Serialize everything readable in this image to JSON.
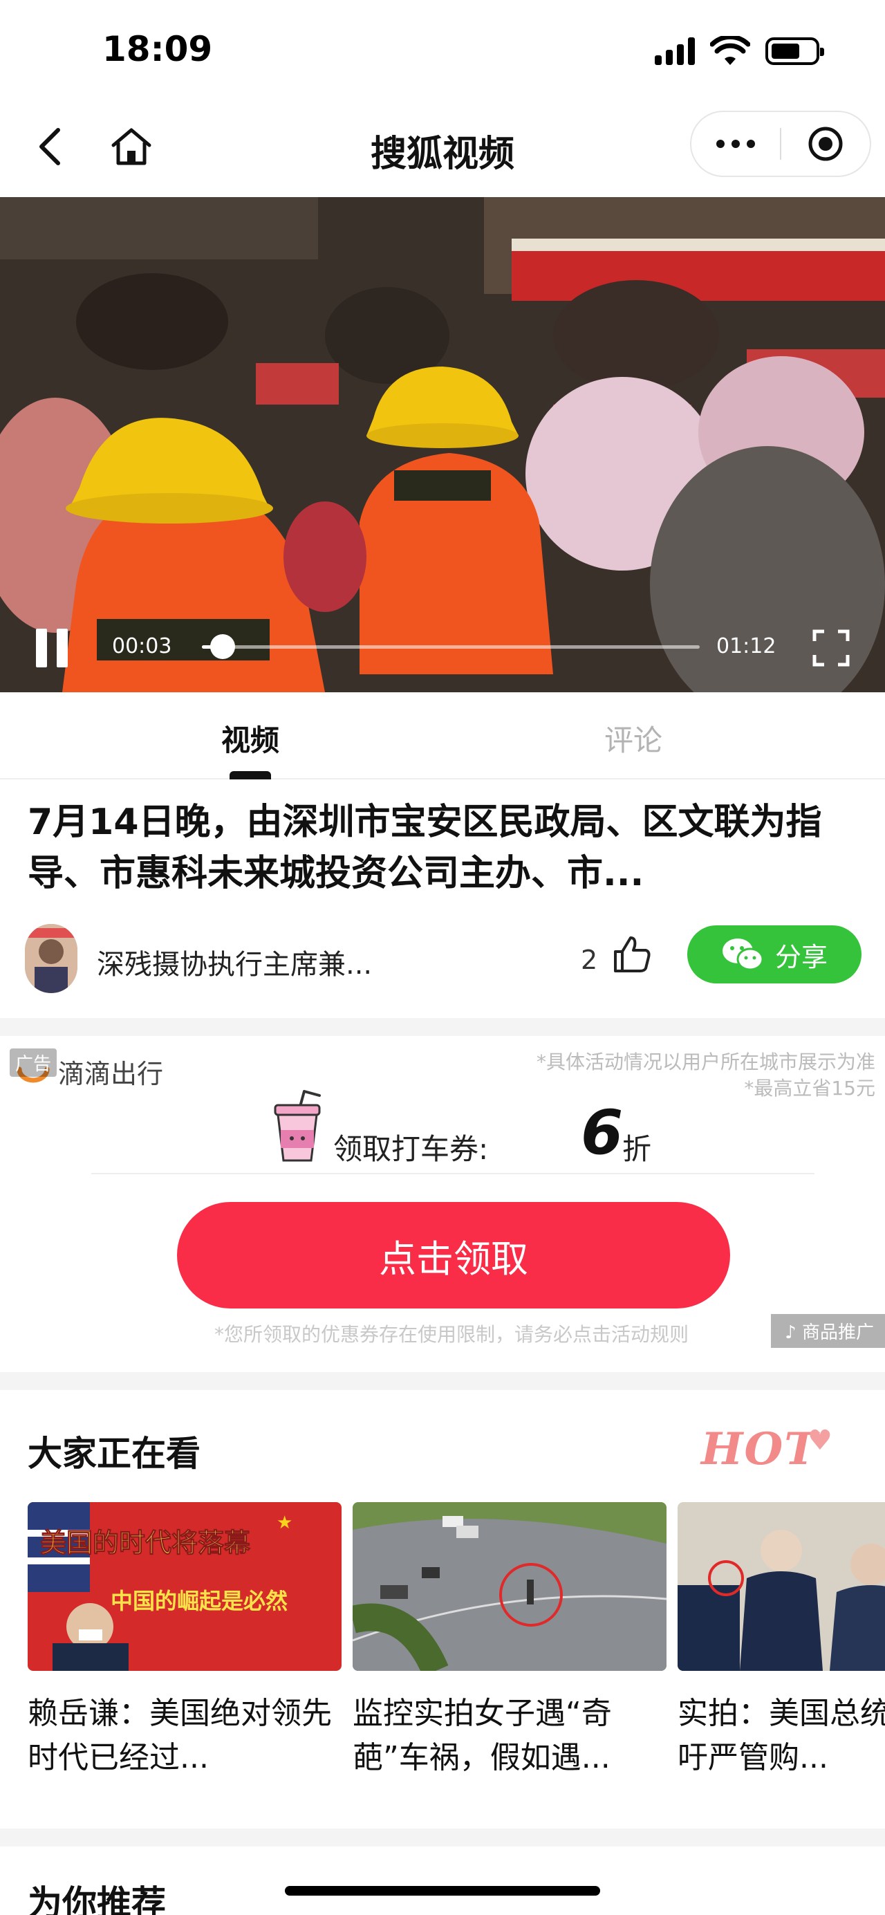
{
  "status_bar": {
    "time": "18:09"
  },
  "nav": {
    "title": "搜狐视频"
  },
  "player": {
    "current_time": "00:03",
    "total_time": "01:12",
    "progress": 0.042
  },
  "tabs": [
    {
      "label": "视频"
    },
    {
      "label": "评论"
    }
  ],
  "article": {
    "title": "7月14日晚，由深圳市宝安区民政局、区文联为指导、市惠科未来城投资公司主办、市...",
    "author": "深残摄协执行主席兼...",
    "likes": "2",
    "share_label": "分享"
  },
  "ad": {
    "badge": "广告",
    "brand": "滴滴出行",
    "note_1": "*具体活动情况以用户所在城市展示为准",
    "note_2": "*最高立省15元",
    "coupon_label": "领取打车券:",
    "coupon_value": "6",
    "coupon_unit": "折",
    "cta": "点击领取",
    "disclaimer": "*您所领取的优惠券存在使用限制，请务必点击活动规则",
    "tag": "♪ 商品推广"
  },
  "trending": {
    "title": "大家正在看",
    "hot_label": "HOT",
    "items": [
      {
        "caption": "赖岳谦：美国绝对领先时代已经过...",
        "thumb_text_1": "美国的时代将落幕",
        "thumb_text_2": "中国的崛起是必然"
      },
      {
        "caption": "监控实拍女子遇“奇葩”车祸，假如遇..."
      },
      {
        "caption": "实拍：美国总统拜登呼吁严管购..."
      }
    ]
  },
  "recommend": {
    "title": "为你推荐"
  },
  "colors": {
    "share_green": "#35c33b",
    "cta_red": "#fa2d48",
    "hot_pink": "#f28a8a"
  }
}
